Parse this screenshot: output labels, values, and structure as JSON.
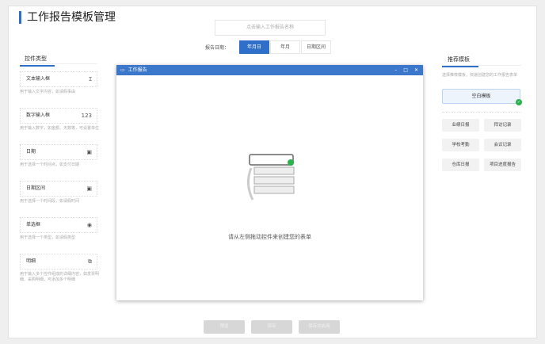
{
  "header": {
    "title": "工作报告模板管理",
    "search_placeholder": "点击输入工作报告名称",
    "date_label": "报告日期：",
    "date_options": [
      "年月日",
      "年月",
      "日期区间"
    ]
  },
  "left": {
    "tab": "控件类型",
    "controls": [
      {
        "label": "文本输入框",
        "icon": "text-cursor-icon",
        "glyph": "Ɪ",
        "desc": "用于输入文字内容，如请假事由"
      },
      {
        "label": "数字输入框",
        "icon": "number-icon",
        "glyph": "123",
        "desc": "用于输入数字，如金额、天数等，可设置单位"
      },
      {
        "label": "日期",
        "icon": "calendar-icon",
        "glyph": "▣",
        "desc": "用于选择一个时间点，如支付日期"
      },
      {
        "label": "日期区间",
        "icon": "calendar-range-icon",
        "glyph": "▣",
        "desc": "用于选择一个时间段，如请假时间"
      },
      {
        "label": "单选框",
        "icon": "radio-icon",
        "glyph": "◉",
        "desc": "用于选择一个类型，如请假类型"
      },
      {
        "label": "明细",
        "icon": "detail-icon",
        "glyph": "⧉",
        "desc": "用于输入多个控件组成的详细内容，如发票明细、采购明细，可添加多个明细"
      }
    ]
  },
  "window": {
    "title": "工作报告",
    "empty_text": "请从左侧拖动控件来创建您的表单"
  },
  "right": {
    "tab": "推荐模板",
    "desc": "选择推荐模板，快速创建您的工作报告表单",
    "blank": "空白模板",
    "templates": [
      "业绩日报",
      "拜访记录",
      "学校考勤",
      "会议记录",
      "仓库日报",
      "项目进度报告"
    ]
  },
  "footer": {
    "buttons": [
      "预览",
      "保存",
      "保存并启用"
    ]
  },
  "colors": {
    "accent": "#2f6fc9",
    "window_header": "#3b78cc",
    "success": "#2bb24c"
  }
}
